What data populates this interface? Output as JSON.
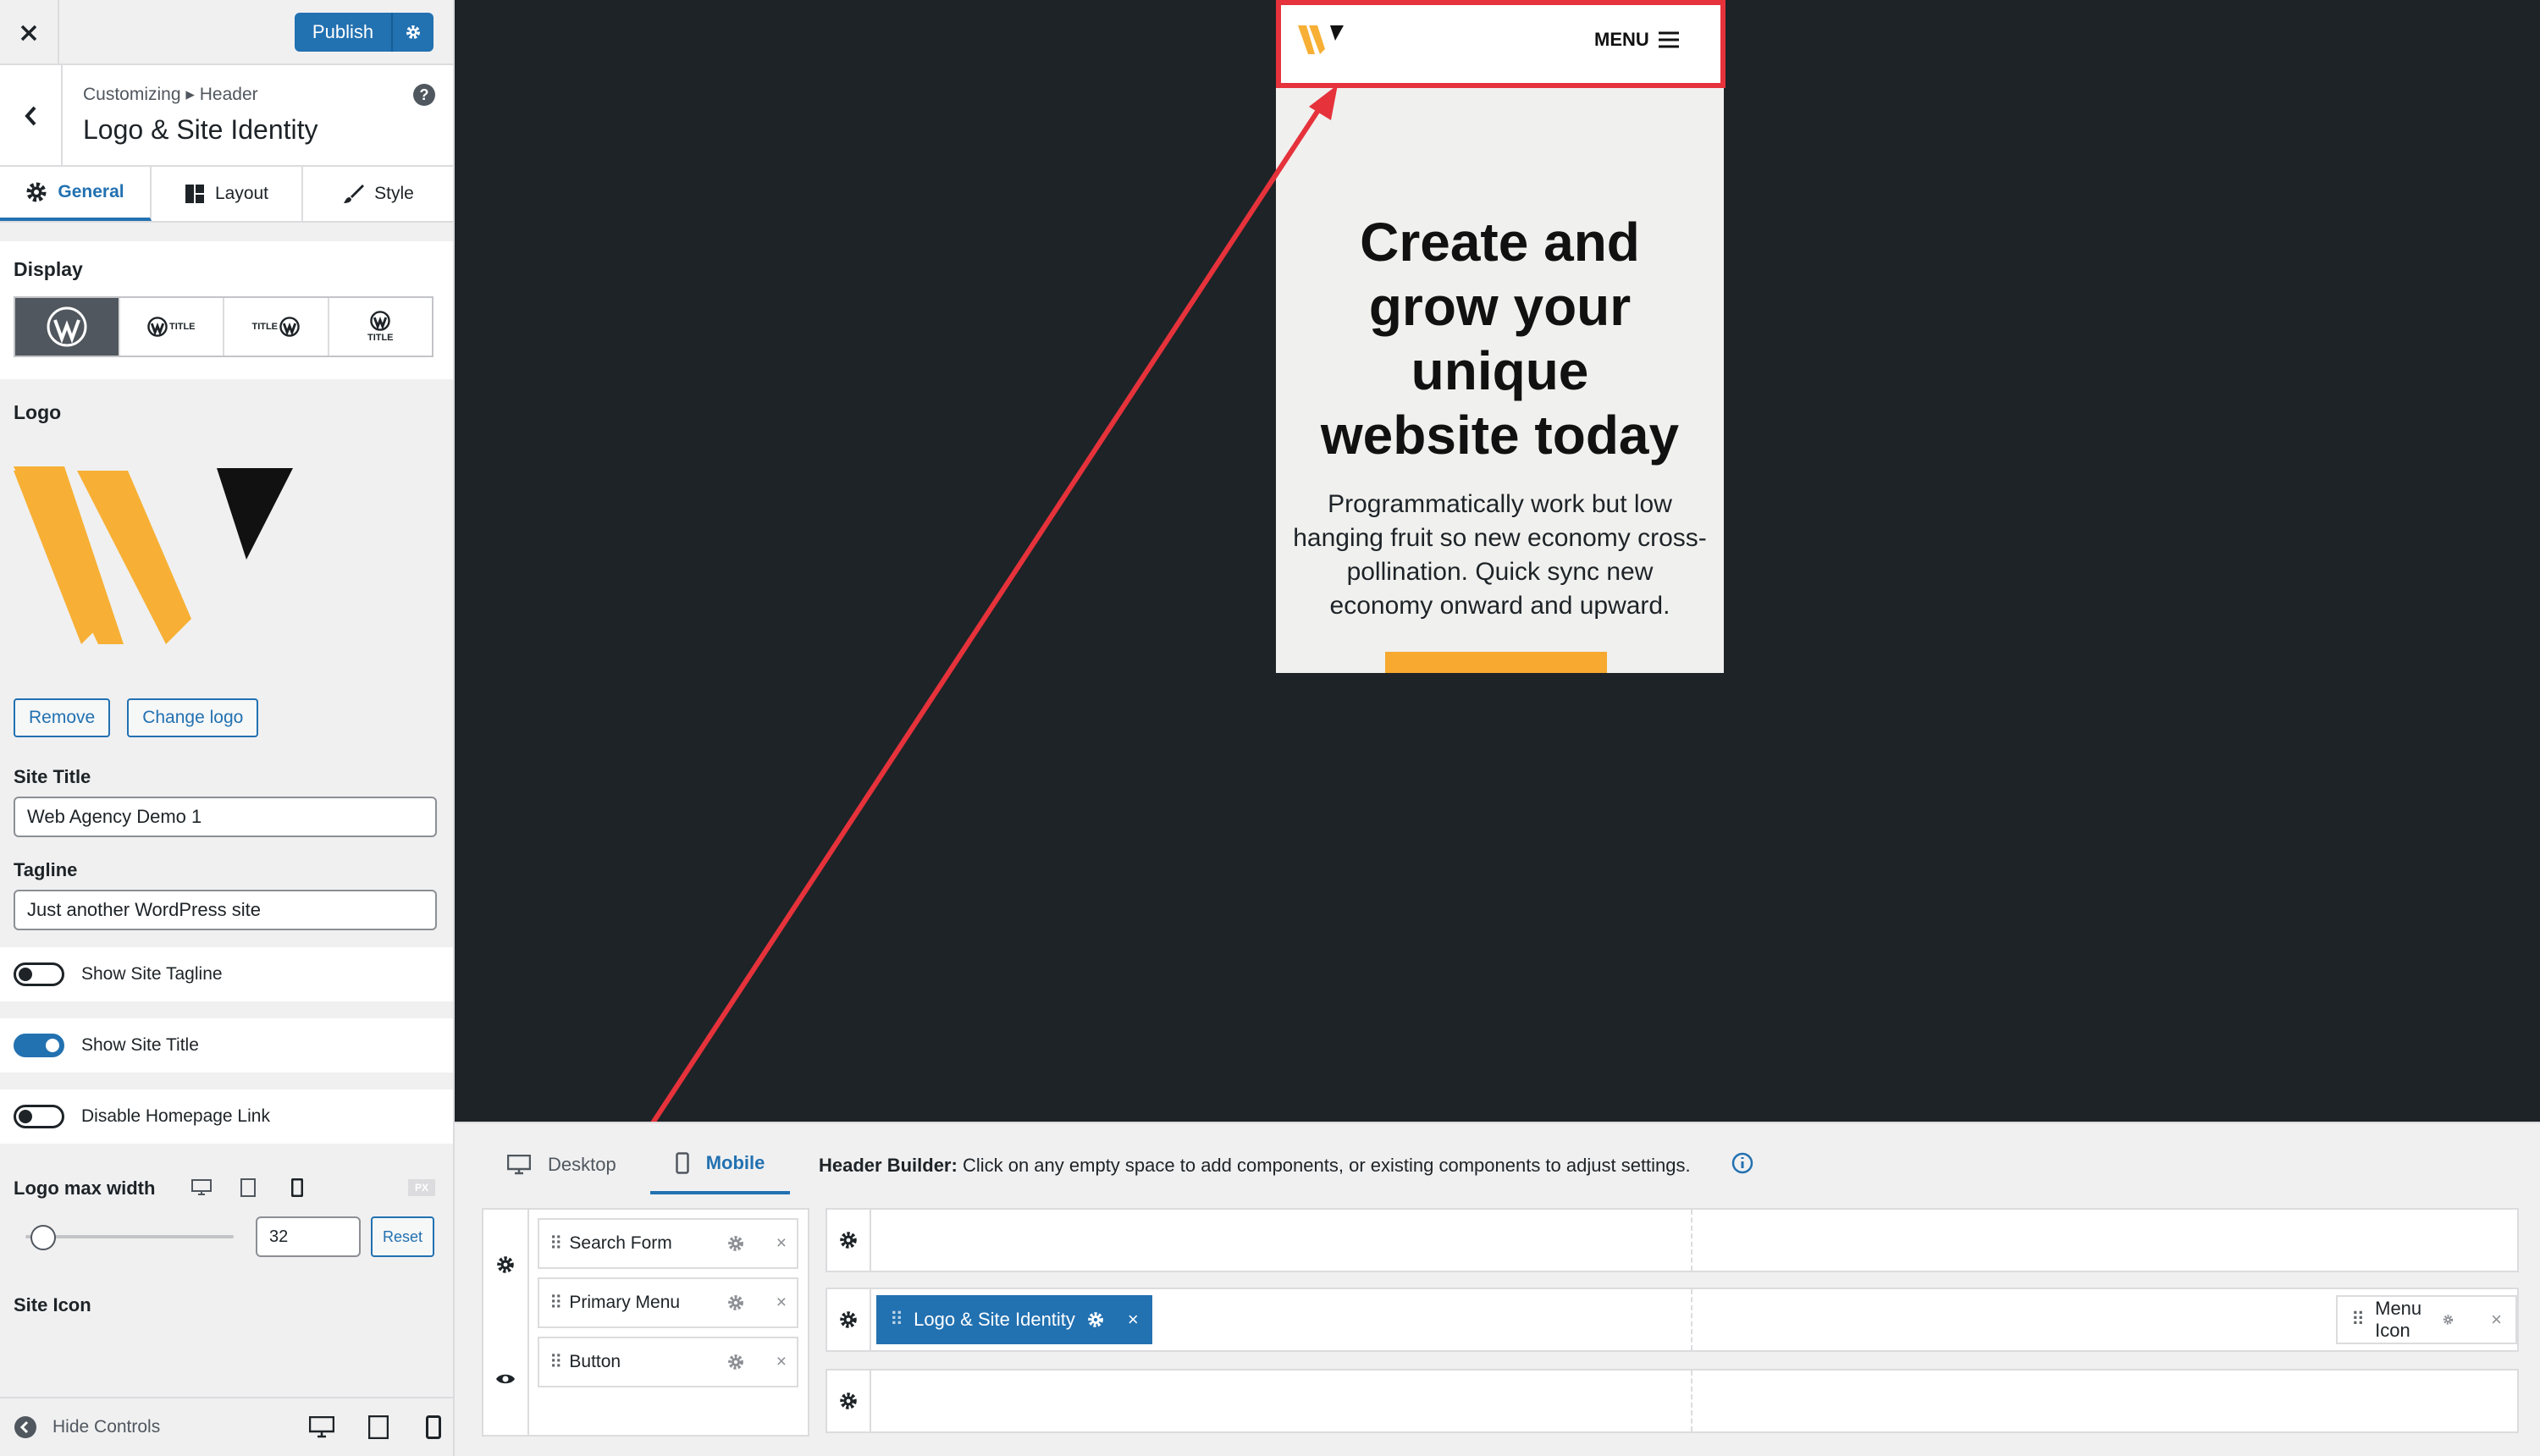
{
  "sidebar": {
    "publish_label": "Publish",
    "breadcrumb": "Customizing ▸ Header",
    "section_title": "Logo & Site Identity",
    "tabs": [
      {
        "label": "General"
      },
      {
        "label": "Layout"
      },
      {
        "label": "Style"
      }
    ],
    "display_label": "Display",
    "display_options": [
      {
        "text": ""
      },
      {
        "text": "TITLE"
      },
      {
        "text": "TITLE"
      },
      {
        "text": "TITLE"
      }
    ],
    "logo_label": "Logo",
    "remove_label": "Remove",
    "change_logo_label": "Change logo",
    "site_title_label": "Site Title",
    "site_title_value": "Web Agency Demo 1",
    "tagline_label": "Tagline",
    "tagline_value": "Just another WordPress site",
    "toggles": [
      {
        "label": "Show Site Tagline",
        "on": false
      },
      {
        "label": "Show Site Title",
        "on": true
      },
      {
        "label": "Disable Homepage Link",
        "on": false
      }
    ],
    "logo_max_width_label": "Logo max width",
    "unit_label": "PX",
    "logo_width_value": "32",
    "reset_label": "Reset",
    "site_icon_label": "Site Icon",
    "hide_controls_label": "Hide Controls"
  },
  "preview": {
    "menu_label": "MENU",
    "hero_title": [
      "Create and",
      "grow your",
      "unique",
      "website today"
    ],
    "hero_text": "Programmatically work but low hanging fruit so new economy cross-pollination. Quick sync new economy onward and upward."
  },
  "builder": {
    "tabs": [
      {
        "label": "Desktop"
      },
      {
        "label": "Mobile"
      }
    ],
    "info_bold": "Header Builder:",
    "info_text": "Click on any empty space to add components, or existing components to adjust settings.",
    "available": [
      {
        "label": "Search Form"
      },
      {
        "label": "Primary Menu"
      },
      {
        "label": "Button"
      }
    ],
    "placed": {
      "logo": "Logo & Site Identity",
      "menu_icon": "Menu Icon"
    }
  },
  "colors": {
    "accent": "#2271b1",
    "highlight": "#e5323b",
    "logo_yellow": "#f7b035",
    "logo_dark": "#111111"
  }
}
